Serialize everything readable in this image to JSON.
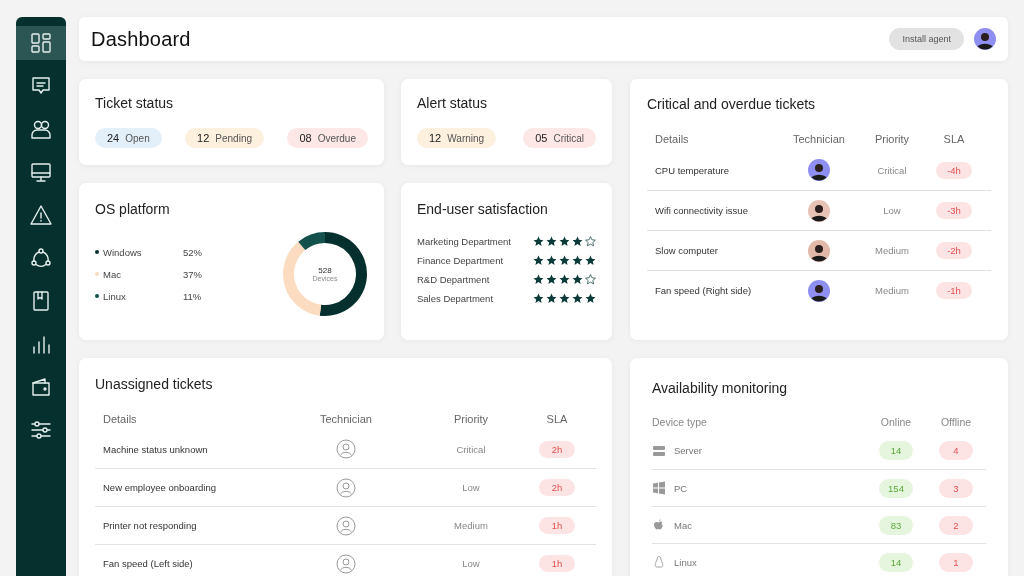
{
  "sidebar": {
    "items": [
      {
        "selected": true
      },
      {
        "selected": false
      },
      {
        "selected": false
      },
      {
        "selected": false
      },
      {
        "selected": false
      },
      {
        "selected": false
      },
      {
        "selected": false
      },
      {
        "selected": false
      },
      {
        "selected": false
      },
      {
        "selected": false
      }
    ]
  },
  "header": {
    "title": "Dashboard",
    "button": "Install agent"
  },
  "ticket_status": {
    "title": "Ticket status",
    "items": [
      {
        "count": "24",
        "label": "Open",
        "color": "#e3f0fa"
      },
      {
        "count": "12",
        "label": "Pending",
        "color": "#fdf0df"
      },
      {
        "count": "08",
        "label": "Overdue",
        "color": "#fde7e7"
      }
    ]
  },
  "alert_status": {
    "title": "Alert status",
    "items": [
      {
        "count": "12",
        "label": "Warning",
        "color": "#fdf0df"
      },
      {
        "count": "05",
        "label": "Critical",
        "color": "#fde7e7"
      }
    ]
  },
  "os_platform": {
    "title": "OS platform",
    "legend": [
      {
        "percent": "52%",
        "color": "#06302e"
      },
      {
        "percent": "37%",
        "color": "#fcdcc0"
      },
      {
        "percent": "11%",
        "color": "#14504c"
      }
    ],
    "center_value": "528",
    "center_label": "Devices",
    "chart_data": {
      "type": "donut",
      "categories": [
        "Windows",
        "Mac",
        "Linux"
      ],
      "series": [
        {
          "values": [
            52,
            37,
            11
          ]
        }
      ]
    }
  },
  "satisfaction": {
    "title": "End-user satisfaction",
    "rows": [
      {
        "department": "Marketing Department",
        "stars": 4
      },
      {
        "department": "Finance Department",
        "stars": 5
      },
      {
        "department": "R&D Department",
        "stars": 4
      },
      {
        "department": "Sales Department",
        "stars": 5
      }
    ]
  },
  "critical_tickets": {
    "title": "Critical and overdue tickets",
    "columns": [
      "Details",
      "Technician",
      "Priority",
      "SLA"
    ],
    "rows": [
      {
        "details": "CPU temperature",
        "technician": {
          "kind": "avatar",
          "color": "#8f8ff2"
        },
        "priority": "Critical",
        "sla": "-4h"
      },
      {
        "details": "Wifi connectivity issue",
        "technician": {
          "kind": "avatar",
          "color": "#e7c3b5"
        },
        "priority": "Low",
        "sla": "-3h"
      },
      {
        "details": "Slow computer",
        "technician": {
          "kind": "avatar",
          "color": "#e2b9a8"
        },
        "priority": "Medium",
        "sla": "-2h"
      },
      {
        "details": "Fan speed (Right side)",
        "technician": {
          "kind": "avatar",
          "color": "#8f8ff2"
        },
        "priority": "Medium",
        "sla": "-1h"
      }
    ]
  },
  "unassigned_tickets": {
    "title": "Unassigned tickets",
    "columns": [
      "Details",
      "Technician",
      "Priority",
      "SLA"
    ],
    "rows": [
      {
        "details": "Machine status unknown",
        "technician": {
          "kind": "unassigned"
        },
        "priority": "Critical",
        "sla": "2h"
      },
      {
        "details": "New employee onboarding",
        "technician": {
          "kind": "unassigned"
        },
        "priority": "Low",
        "sla": "2h"
      },
      {
        "details": "Printer not responding",
        "technician": {
          "kind": "unassigned"
        },
        "priority": "Medium",
        "sla": "1h"
      },
      {
        "details": "Fan speed (Left side)",
        "technician": {
          "kind": "unassigned"
        },
        "priority": "Low",
        "sla": "1h"
      }
    ]
  },
  "availability": {
    "title": "Availability monitoring",
    "columns": [
      "Device type",
      "Online",
      "Offline"
    ],
    "rows": [
      {
        "device": "Server",
        "online": "14",
        "offline": "4"
      },
      {
        "device": "PC",
        "online": "154",
        "offline": "3"
      },
      {
        "device": "Mac",
        "online": "83",
        "offline": "2"
      },
      {
        "device": "Linux",
        "online": "14",
        "offline": "1"
      }
    ]
  }
}
